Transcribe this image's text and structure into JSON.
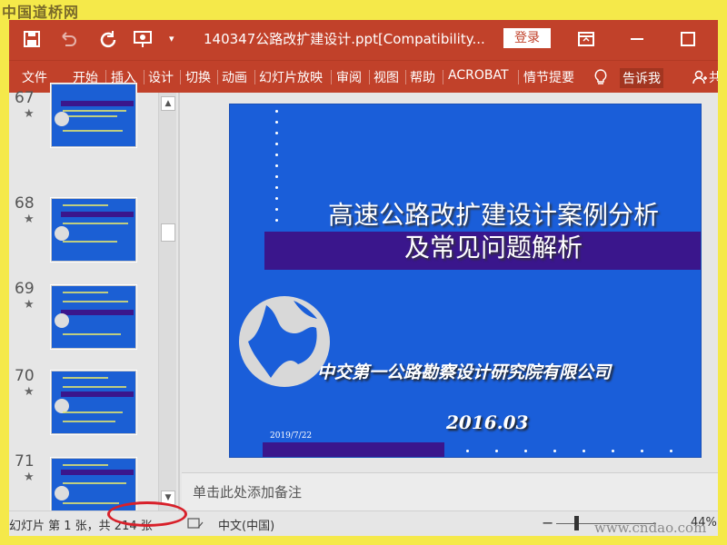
{
  "watermark": {
    "top_left": "中国道桥网",
    "bottom_right": "www.cndao.com"
  },
  "titlebar": {
    "document_title": "140347公路改扩建设计.ppt[Compatibility...",
    "login_label": "登录",
    "icons": [
      "save-icon",
      "undo-icon",
      "redo-icon",
      "present-icon",
      "customize-icon",
      "ribbon-display-icon",
      "maximize-icon"
    ]
  },
  "menu": {
    "items": [
      "文件",
      "开始",
      "插入",
      "设计",
      "切换",
      "动画",
      "幻灯片放映",
      "审阅",
      "视图",
      "帮助",
      "ACROBAT",
      "情节提要"
    ],
    "tell_me": "告诉我",
    "share_label": "共"
  },
  "thumbnails": [
    {
      "number": "67",
      "star": "★"
    },
    {
      "number": "68",
      "star": "★"
    },
    {
      "number": "69",
      "star": "★"
    },
    {
      "number": "70",
      "star": "★"
    },
    {
      "number": "71",
      "star": "★"
    }
  ],
  "slide": {
    "title_line1": "高速公路改扩建设计案例分析",
    "title_line2": "及常见问题解析",
    "organization": "中交第一公路勘察设计研究院有限公司",
    "date_large": "2016.03",
    "date_small": "2019/7/22"
  },
  "notes_placeholder": "单击此处添加备注",
  "statusbar": {
    "slide_info": "幻灯片 第 1 张，共 214 张",
    "language": "中文(中国)",
    "zoom_minus": "−",
    "zoom_percent": "44%"
  },
  "colors": {
    "ribbon": "#c1412a",
    "slide_bg": "#1a5ed9",
    "slide_band": "#3a168c",
    "highlight": "#d8202a"
  }
}
